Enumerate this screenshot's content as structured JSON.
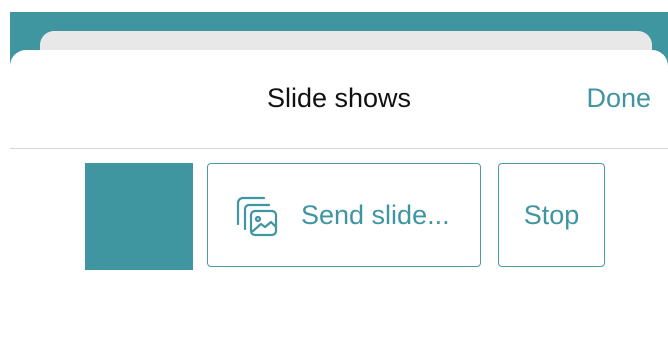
{
  "sheet": {
    "title": "Slide shows",
    "done_label": "Done"
  },
  "actions": {
    "send_slide_label": "Send slide...",
    "stop_label": "Stop"
  },
  "icons": {
    "send_slide": "slides-image-icon"
  },
  "colors": {
    "accent": "#3f95a0",
    "backdrop": "#3f95a0"
  }
}
